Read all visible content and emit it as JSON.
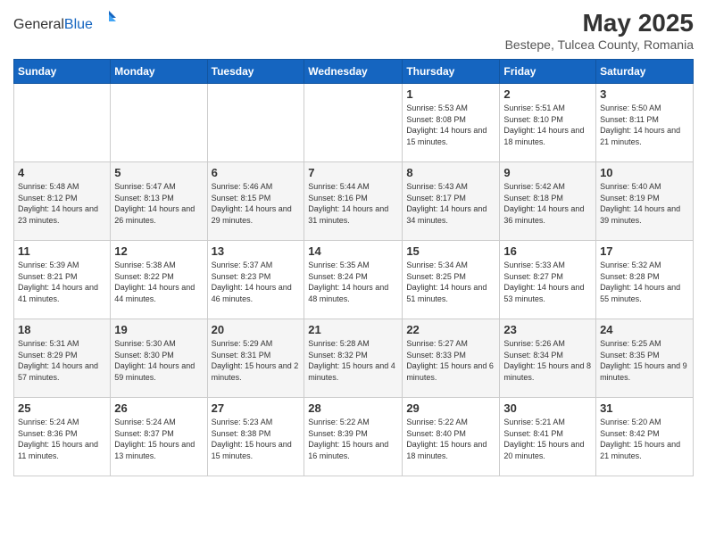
{
  "header": {
    "logo_general": "General",
    "logo_blue": "Blue",
    "main_title": "May 2025",
    "subtitle": "Bestepe, Tulcea County, Romania"
  },
  "calendar": {
    "days_of_week": [
      "Sunday",
      "Monday",
      "Tuesday",
      "Wednesday",
      "Thursday",
      "Friday",
      "Saturday"
    ],
    "weeks": [
      [
        {
          "day": "",
          "info": ""
        },
        {
          "day": "",
          "info": ""
        },
        {
          "day": "",
          "info": ""
        },
        {
          "day": "",
          "info": ""
        },
        {
          "day": "1",
          "info": "Sunrise: 5:53 AM\nSunset: 8:08 PM\nDaylight: 14 hours and 15 minutes."
        },
        {
          "day": "2",
          "info": "Sunrise: 5:51 AM\nSunset: 8:10 PM\nDaylight: 14 hours and 18 minutes."
        },
        {
          "day": "3",
          "info": "Sunrise: 5:50 AM\nSunset: 8:11 PM\nDaylight: 14 hours and 21 minutes."
        }
      ],
      [
        {
          "day": "4",
          "info": "Sunrise: 5:48 AM\nSunset: 8:12 PM\nDaylight: 14 hours and 23 minutes."
        },
        {
          "day": "5",
          "info": "Sunrise: 5:47 AM\nSunset: 8:13 PM\nDaylight: 14 hours and 26 minutes."
        },
        {
          "day": "6",
          "info": "Sunrise: 5:46 AM\nSunset: 8:15 PM\nDaylight: 14 hours and 29 minutes."
        },
        {
          "day": "7",
          "info": "Sunrise: 5:44 AM\nSunset: 8:16 PM\nDaylight: 14 hours and 31 minutes."
        },
        {
          "day": "8",
          "info": "Sunrise: 5:43 AM\nSunset: 8:17 PM\nDaylight: 14 hours and 34 minutes."
        },
        {
          "day": "9",
          "info": "Sunrise: 5:42 AM\nSunset: 8:18 PM\nDaylight: 14 hours and 36 minutes."
        },
        {
          "day": "10",
          "info": "Sunrise: 5:40 AM\nSunset: 8:19 PM\nDaylight: 14 hours and 39 minutes."
        }
      ],
      [
        {
          "day": "11",
          "info": "Sunrise: 5:39 AM\nSunset: 8:21 PM\nDaylight: 14 hours and 41 minutes."
        },
        {
          "day": "12",
          "info": "Sunrise: 5:38 AM\nSunset: 8:22 PM\nDaylight: 14 hours and 44 minutes."
        },
        {
          "day": "13",
          "info": "Sunrise: 5:37 AM\nSunset: 8:23 PM\nDaylight: 14 hours and 46 minutes."
        },
        {
          "day": "14",
          "info": "Sunrise: 5:35 AM\nSunset: 8:24 PM\nDaylight: 14 hours and 48 minutes."
        },
        {
          "day": "15",
          "info": "Sunrise: 5:34 AM\nSunset: 8:25 PM\nDaylight: 14 hours and 51 minutes."
        },
        {
          "day": "16",
          "info": "Sunrise: 5:33 AM\nSunset: 8:27 PM\nDaylight: 14 hours and 53 minutes."
        },
        {
          "day": "17",
          "info": "Sunrise: 5:32 AM\nSunset: 8:28 PM\nDaylight: 14 hours and 55 minutes."
        }
      ],
      [
        {
          "day": "18",
          "info": "Sunrise: 5:31 AM\nSunset: 8:29 PM\nDaylight: 14 hours and 57 minutes."
        },
        {
          "day": "19",
          "info": "Sunrise: 5:30 AM\nSunset: 8:30 PM\nDaylight: 14 hours and 59 minutes."
        },
        {
          "day": "20",
          "info": "Sunrise: 5:29 AM\nSunset: 8:31 PM\nDaylight: 15 hours and 2 minutes."
        },
        {
          "day": "21",
          "info": "Sunrise: 5:28 AM\nSunset: 8:32 PM\nDaylight: 15 hours and 4 minutes."
        },
        {
          "day": "22",
          "info": "Sunrise: 5:27 AM\nSunset: 8:33 PM\nDaylight: 15 hours and 6 minutes."
        },
        {
          "day": "23",
          "info": "Sunrise: 5:26 AM\nSunset: 8:34 PM\nDaylight: 15 hours and 8 minutes."
        },
        {
          "day": "24",
          "info": "Sunrise: 5:25 AM\nSunset: 8:35 PM\nDaylight: 15 hours and 9 minutes."
        }
      ],
      [
        {
          "day": "25",
          "info": "Sunrise: 5:24 AM\nSunset: 8:36 PM\nDaylight: 15 hours and 11 minutes."
        },
        {
          "day": "26",
          "info": "Sunrise: 5:24 AM\nSunset: 8:37 PM\nDaylight: 15 hours and 13 minutes."
        },
        {
          "day": "27",
          "info": "Sunrise: 5:23 AM\nSunset: 8:38 PM\nDaylight: 15 hours and 15 minutes."
        },
        {
          "day": "28",
          "info": "Sunrise: 5:22 AM\nSunset: 8:39 PM\nDaylight: 15 hours and 16 minutes."
        },
        {
          "day": "29",
          "info": "Sunrise: 5:22 AM\nSunset: 8:40 PM\nDaylight: 15 hours and 18 minutes."
        },
        {
          "day": "30",
          "info": "Sunrise: 5:21 AM\nSunset: 8:41 PM\nDaylight: 15 hours and 20 minutes."
        },
        {
          "day": "31",
          "info": "Sunrise: 5:20 AM\nSunset: 8:42 PM\nDaylight: 15 hours and 21 minutes."
        }
      ]
    ]
  }
}
